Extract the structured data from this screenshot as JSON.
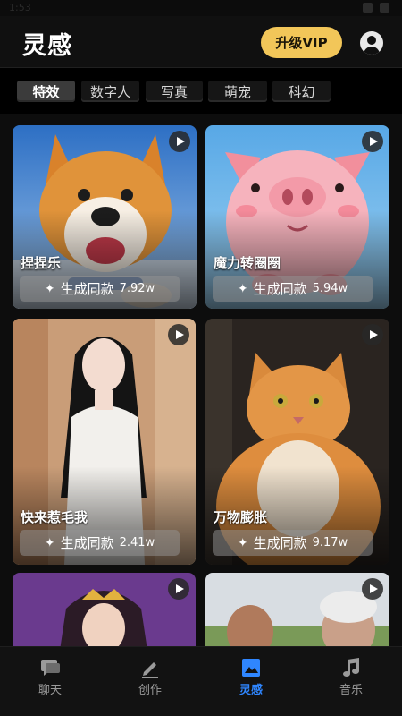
{
  "app": {
    "title": "灵感"
  },
  "header": {
    "vip_label": "升级VIP"
  },
  "tabs": [
    {
      "label": "特效",
      "active": true
    },
    {
      "label": "数字人",
      "active": false
    },
    {
      "label": "写真",
      "active": false
    },
    {
      "label": "萌宠",
      "active": false
    },
    {
      "label": "科幻",
      "active": false
    }
  ],
  "cards": [
    {
      "title": "捏捏乐",
      "action_label": "生成同款",
      "count": "7.92w",
      "icon": "sparkle-icon"
    },
    {
      "title": "魔力转圈圈",
      "action_label": "生成同款",
      "count": "5.94w",
      "icon": "sparkle-icon"
    },
    {
      "title": "快来惹毛我",
      "action_label": "生成同款",
      "count": "2.41w",
      "icon": "sparkle-icon"
    },
    {
      "title": "万物膨胀",
      "action_label": "生成同款",
      "count": "9.17w",
      "icon": "sparkle-icon"
    },
    {
      "title": "",
      "action_label": "",
      "count": ""
    },
    {
      "title": "",
      "action_label": "",
      "count": ""
    }
  ],
  "bottom_nav": [
    {
      "label": "聊天",
      "icon": "chat-icon",
      "active": false
    },
    {
      "label": "创作",
      "icon": "pencil-icon",
      "active": false
    },
    {
      "label": "灵感",
      "icon": "image-icon",
      "active": true
    },
    {
      "label": "音乐",
      "icon": "music-note-icon",
      "active": false
    }
  ],
  "colors": {
    "accent": "#2f86ff",
    "vip": "#f2c659",
    "background": "#000000"
  }
}
